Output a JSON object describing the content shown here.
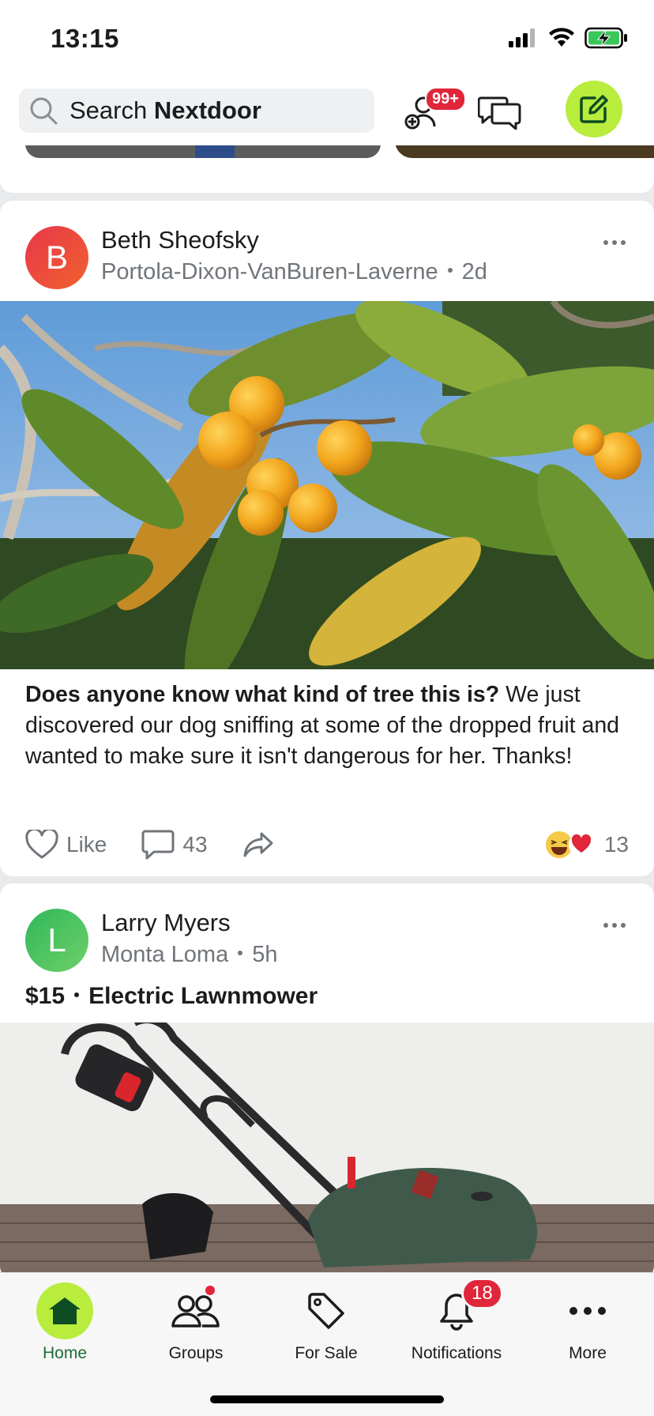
{
  "status_bar": {
    "time": "13:15",
    "icons": [
      "signal-icon",
      "wifi-icon",
      "battery-charging-icon"
    ]
  },
  "top_bar": {
    "search_prefix": "Search ",
    "search_brand": "Nextdoor",
    "invite_badge": "99+",
    "icons": [
      "search-icon",
      "add-neighbor-icon",
      "messages-icon",
      "compose-icon"
    ],
    "accent_color": "#b8ec3d"
  },
  "posts": [
    {
      "avatar_letter": "B",
      "avatar_color": "#e63b3b",
      "author": "Beth Sheofsky",
      "neighborhood": "Portola-Dixon-VanBuren-Laverne",
      "age": "2d",
      "text_bold": "Does anyone know what kind of tree this is?",
      "text": " We just discovered our dog sniffing at some of the dropped fruit and wanted to make sure it isn't dangerous for her. Thanks!",
      "like_label": "Like",
      "comment_count": "43",
      "reaction_count": "13",
      "reactions": [
        "laugh-emoji",
        "heart-emoji"
      ]
    },
    {
      "avatar_letter": "L",
      "avatar_color": "#3cc35a",
      "author": "Larry Myers",
      "neighborhood": "Monta Loma",
      "age": "5h",
      "price": "$15",
      "title": "Electric Lawnmower"
    }
  ],
  "bottom_nav": {
    "items": [
      {
        "label": "Home",
        "icon": "home-icon",
        "active": true
      },
      {
        "label": "Groups",
        "icon": "groups-icon"
      },
      {
        "label": "For Sale",
        "icon": "price-tag-icon"
      },
      {
        "label": "Notifications",
        "icon": "bell-icon",
        "badge": "18"
      },
      {
        "label": "More",
        "icon": "more-icon"
      }
    ]
  }
}
